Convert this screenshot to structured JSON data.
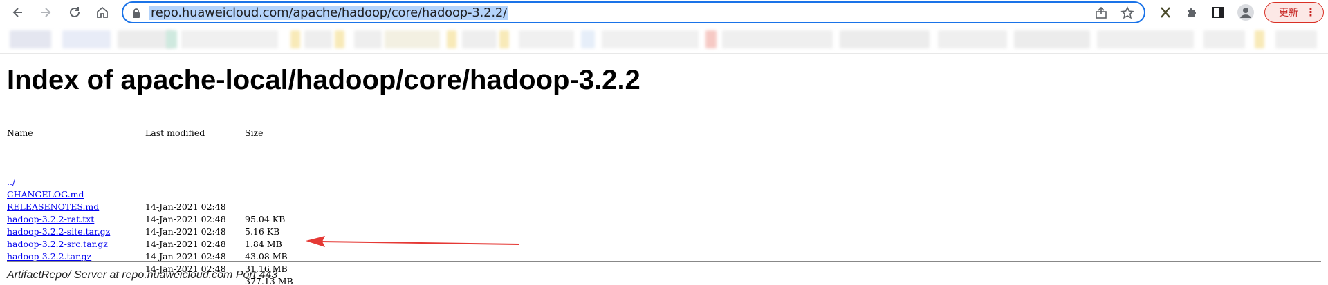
{
  "browser": {
    "url": "repo.huaweicloud.com/apache/hadoop/core/hadoop-3.2.2/",
    "update_label": "更新",
    "menu_glyph": "⋮"
  },
  "page": {
    "title": "Index of apache-local/hadoop/core/hadoop-3.2.2",
    "headers": {
      "name": "Name",
      "modified": "Last modified",
      "size": "Size"
    },
    "parent": "../",
    "files": [
      {
        "name": "CHANGELOG.md",
        "modified": "14-Jan-2021 02:48",
        "size": "95.04 KB"
      },
      {
        "name": "RELEASENOTES.md",
        "modified": "14-Jan-2021 02:48",
        "size": "5.16 KB"
      },
      {
        "name": "hadoop-3.2.2-rat.txt",
        "modified": "14-Jan-2021 02:48",
        "size": "1.84 MB"
      },
      {
        "name": "hadoop-3.2.2-site.tar.gz",
        "modified": "14-Jan-2021 02:48",
        "size": "43.08 MB"
      },
      {
        "name": "hadoop-3.2.2-src.tar.gz",
        "modified": "14-Jan-2021 02:48",
        "size": "31.16 MB"
      },
      {
        "name": "hadoop-3.2.2.tar.gz",
        "modified": "14-Jan-2021 02:48",
        "size": "377.13 MB"
      }
    ],
    "footer": "ArtifactRepo/ Server at repo.huaweicloud.com Port 443"
  },
  "colors": {
    "link": "#0000ee",
    "omnibox_border": "#1a73e8",
    "url_selection": "#b4d3fb",
    "annotation_arrow": "#e53935",
    "update_button": "#d93025"
  },
  "icons": [
    "back-icon",
    "forward-icon",
    "reload-icon",
    "home-icon",
    "lock-icon",
    "share-icon",
    "star-icon",
    "extension-x-icon",
    "puzzle-icon",
    "sidebar-icon",
    "profile-icon"
  ]
}
